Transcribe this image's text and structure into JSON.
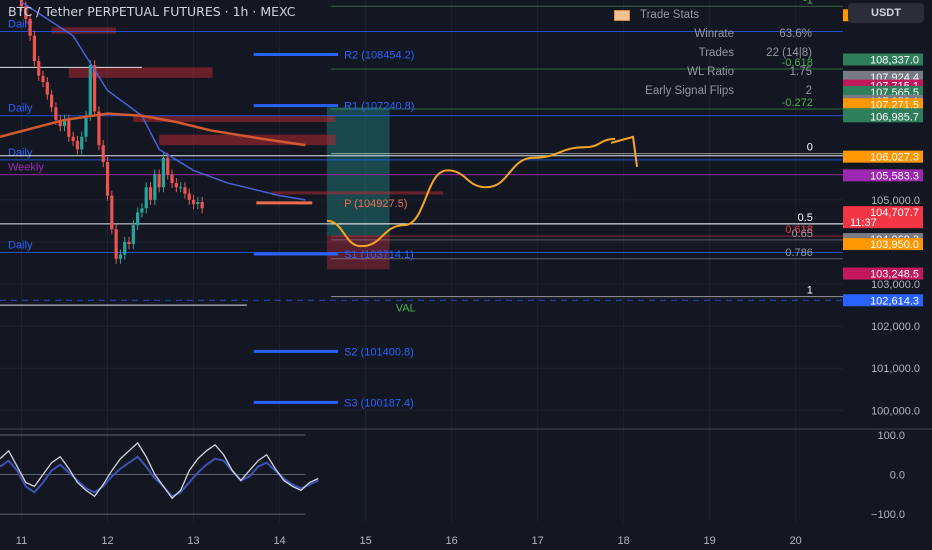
{
  "header": {
    "symbol": "BTC / Tether PERPETUAL FUTURES · 1h · MEXC",
    "currency_button": "USDT"
  },
  "trade_stats": {
    "title": "Trade Stats",
    "rows": [
      {
        "label": "Winrate",
        "value": "63.6%"
      },
      {
        "label": "Trades",
        "value": "22 (14|8)"
      },
      {
        "label": "WL Ratio",
        "value": "1.75"
      },
      {
        "label": "Early Signal Flips",
        "value": "2"
      }
    ]
  },
  "chart_data": [
    {
      "type": "candlestick",
      "title": "BTC / Tether PERPETUAL FUTURES · 1h · MEXC",
      "x_ticks": [
        {
          "label": "11",
          "day": 11
        },
        {
          "label": "12",
          "day": 12
        },
        {
          "label": "13",
          "day": 13
        },
        {
          "label": "14",
          "day": 14
        },
        {
          "label": "15",
          "day": 15
        },
        {
          "label": "16",
          "day": 16
        },
        {
          "label": "17",
          "day": 17
        },
        {
          "label": "18",
          "day": 18
        },
        {
          "label": "19",
          "day": 19
        },
        {
          "label": "20",
          "day": 20
        }
      ],
      "y_ticks": [
        "105,000.0",
        "104,000.0",
        "103,000.0",
        "102,000.0",
        "101,000.0",
        "100,000.0"
      ],
      "y_tick_values": [
        105000,
        104000,
        103000,
        102000,
        101000,
        100000
      ],
      "ylim": [
        99650,
        109750
      ],
      "xlim": [
        10.75,
        20.55
      ],
      "price_close": [
        109600,
        109300,
        108900,
        108300,
        107950,
        107800,
        107500,
        107200,
        106900,
        106750,
        106900,
        106500,
        106400,
        106200,
        106500,
        107000,
        108200,
        107100,
        106300,
        105900,
        105100,
        104300,
        103600,
        103700,
        104000,
        103950,
        104400,
        104700,
        104800,
        105300,
        105000,
        105600,
        105300,
        106000,
        105600,
        105400,
        105300,
        105300,
        105150,
        105000,
        104900,
        104950,
        104800
      ],
      "price_start_day": 11.0,
      "price_step_day": 0.05,
      "moving_averages": [
        {
          "color": "#4a62d8",
          "points": [
            [
              11.0,
              109700
            ],
            [
              11.6,
              108900
            ],
            [
              12.0,
              107600
            ],
            [
              12.4,
              107000
            ],
            [
              12.6,
              106200
            ],
            [
              13.0,
              105700
            ],
            [
              13.4,
              105400
            ],
            [
              14.0,
              105100
            ],
            [
              14.3,
              105000
            ]
          ]
        },
        {
          "color": "#d25a2e",
          "points": [
            [
              10.75,
              106500
            ],
            [
              11.5,
              106900
            ],
            [
              12.0,
              107050
            ],
            [
              12.4,
              107000
            ],
            [
              12.8,
              106850
            ],
            [
              13.2,
              106650
            ],
            [
              13.8,
              106450
            ],
            [
              14.3,
              106300
            ]
          ]
        }
      ],
      "pivots": [
        {
          "label": "R2 (108454.2)",
          "price": 108454.2,
          "color": "#2962ff"
        },
        {
          "label": "R1 (107240.8)",
          "price": 107240.8,
          "color": "#2962ff"
        },
        {
          "label": "P (104927.5)",
          "price": 104927.5,
          "color": "#ef6d4e"
        },
        {
          "label": "S1 (103714.1)",
          "price": 103714.1,
          "color": "#2962ff"
        },
        {
          "label": "S2 (101400.8)",
          "price": 101400.8,
          "color": "#2962ff"
        },
        {
          "label": "S3 (100187.4)",
          "price": 100187.4,
          "color": "#2962ff"
        }
      ],
      "fib_levels": [
        {
          "label": "-1",
          "price": 109600,
          "color": "#4caf50"
        },
        {
          "label": "-0.618",
          "price": 108110,
          "color": "#4caf50"
        },
        {
          "label": "-0.272",
          "price": 107160,
          "color": "#4caf50"
        },
        {
          "label": "0",
          "price": 106100,
          "color": "#ffffff"
        },
        {
          "label": "0.5",
          "price": 104430,
          "color": "#ffffff"
        },
        {
          "label": "0.618",
          "price": 104140,
          "color": "#f23645"
        },
        {
          "label": "0.65",
          "price": 104050,
          "color": "#9598a1"
        },
        {
          "label": "0.786",
          "price": 103600,
          "color": "#9598a1"
        },
        {
          "label": "1",
          "price": 102700,
          "color": "#ffffff"
        }
      ],
      "level_lines": [
        {
          "label": "Daily",
          "price": 109000,
          "color": "#2962ff"
        },
        {
          "label": "Daily",
          "price": 107000,
          "color": "#2962ff"
        },
        {
          "label": "Daily",
          "price": 105950,
          "color": "#2962ff"
        },
        {
          "label": "Weekly",
          "price": 105600,
          "color": "#9c27b0"
        },
        {
          "label": "Daily",
          "price": 103750,
          "color": "#2962ff"
        },
        {
          "label": "VAL",
          "price": 102614.3,
          "color": "#4caf50"
        }
      ],
      "price_tags": [
        {
          "text": "109,386.9",
          "price": 109386.9,
          "color": "#ff9800"
        },
        {
          "text": "108,337.0",
          "price": 108337.0,
          "color": "#2e7d5b"
        },
        {
          "text": "107,924.4",
          "price": 107924.4,
          "color": "#787b86"
        },
        {
          "text": "107,715.1",
          "price": 107715.1,
          "color": "#c2185b"
        },
        {
          "text": "107,565.5",
          "price": 107565.5,
          "color": "#2e7d5b"
        },
        {
          "text": "107,352.1",
          "price": 107352.1,
          "color": "#787b86"
        },
        {
          "text": "107,271.5",
          "price": 107271.5,
          "color": "#ff9800"
        },
        {
          "text": "107,035.5",
          "price": 107035.5,
          "color": "#2e7d5b"
        },
        {
          "text": "106,985.7",
          "price": 106985.7,
          "color": "#2e7d5b"
        },
        {
          "text": "106,027.3",
          "price": 106027.3,
          "color": "#ff9800"
        },
        {
          "text": "105,583.3",
          "price": 105583.3,
          "color": "#9c27b0"
        },
        {
          "text": "104,707.7",
          "price": 104707.7,
          "color": "#f23645",
          "sub": "11:37"
        },
        {
          "text": "104,069.3",
          "price": 104069.3,
          "color": "#787b86"
        },
        {
          "text": "103,950.0",
          "price": 103950.0,
          "color": "#ff9800"
        },
        {
          "text": "103,248.5",
          "price": 103248.5,
          "color": "#c2185b"
        },
        {
          "text": "102,614.3",
          "price": 102614.3,
          "color": "#2962ff"
        }
      ],
      "projection": [
        [
          14.55,
          104500
        ],
        [
          14.95,
          103900
        ],
        [
          15.45,
          104400
        ],
        [
          15.95,
          105700
        ],
        [
          16.4,
          105300
        ],
        [
          16.95,
          106000
        ],
        [
          17.55,
          106250
        ],
        [
          17.9,
          106450
        ]
      ]
    },
    {
      "type": "line",
      "title": "",
      "y_ticks": [
        "100.0",
        "0.0",
        "−100.0"
      ],
      "y_tick_values": [
        100,
        0,
        -100
      ],
      "ylim": [
        -120,
        105
      ],
      "xlim": [
        10.75,
        20.55
      ],
      "series": [
        {
          "color": "#3f51b5",
          "values": [
            20,
            35,
            10,
            -30,
            -45,
            -20,
            10,
            25,
            5,
            -15,
            -35,
            -45,
            -30,
            -5,
            15,
            30,
            45,
            20,
            -10,
            -30,
            -55,
            -45,
            -20,
            5,
            25,
            40,
            35,
            10,
            -15,
            -5,
            20,
            30,
            10,
            -10,
            -25,
            -35,
            -25,
            -15
          ]
        },
        {
          "color": "#d1d4dc",
          "values": [
            40,
            60,
            20,
            -20,
            -30,
            0,
            30,
            45,
            15,
            -20,
            -40,
            -55,
            -25,
            10,
            40,
            60,
            80,
            45,
            0,
            -30,
            -60,
            -40,
            10,
            40,
            60,
            75,
            50,
            10,
            -15,
            10,
            35,
            50,
            15,
            -15,
            -30,
            -40,
            -20,
            -10
          ]
        }
      ],
      "series_start_day": 10.75,
      "series_step_day": 0.1
    }
  ]
}
